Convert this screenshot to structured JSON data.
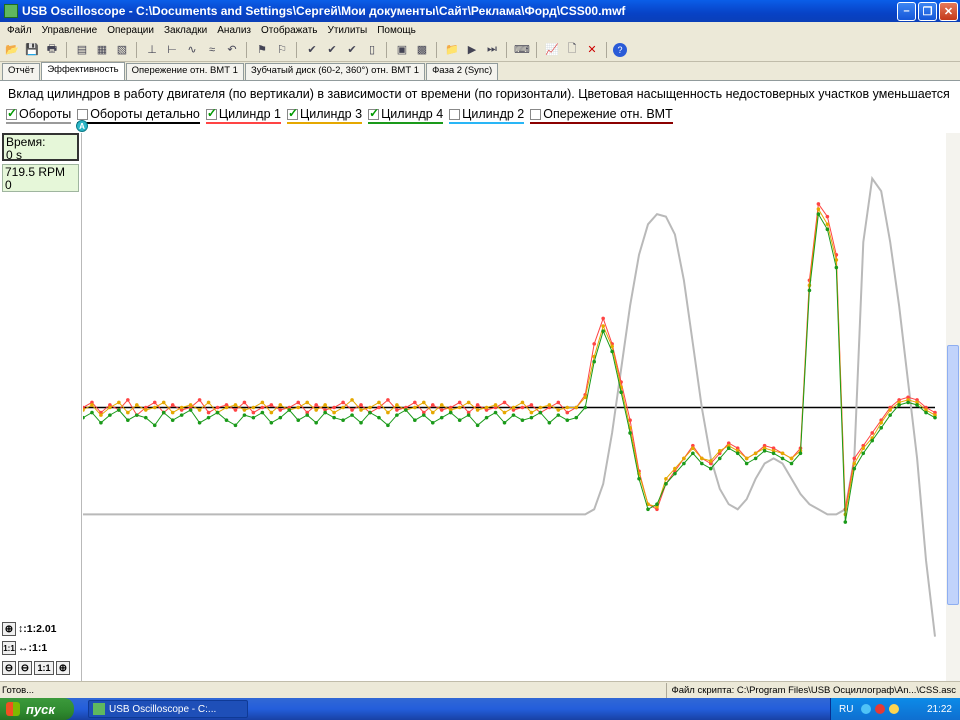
{
  "window": {
    "title": "USB Oscilloscope - C:\\Documents and Settings\\Сергей\\Мои документы\\Сайт\\Реклама\\Форд\\CSS00.mwf"
  },
  "menu": [
    "Файл",
    "Управление",
    "Операции",
    "Закладки",
    "Анализ",
    "Отображать",
    "Утилиты",
    "Помощь"
  ],
  "tabs": [
    "Отчёт",
    "Эффективность",
    "Опережение отн. ВМТ 1",
    "Зубчатый диск (60-2, 360°) отн. ВМТ 1",
    "Фаза 2 (Sync)"
  ],
  "description": "Вклад цилиндров в работу двигателя (по вертикали) в зависимости от времени (по горизонтали). Цветовая насыщенность недостоверных участков уменьшается",
  "legend": [
    {
      "label": "Обороты",
      "checked": true,
      "color": "#9a9a9a"
    },
    {
      "label": "Обороты детально",
      "checked": false,
      "color": "#000000"
    },
    {
      "label": "Цилиндр 1",
      "checked": true,
      "color": "#ff4444"
    },
    {
      "label": "Цилиндр 3",
      "checked": true,
      "color": "#e5a800"
    },
    {
      "label": "Цилиндр 4",
      "checked": true,
      "color": "#1a9a1a"
    },
    {
      "label": "Цилиндр 2",
      "checked": false,
      "color": "#29b6f6"
    },
    {
      "label": "Опережение отн. ВМТ",
      "checked": false,
      "color": "#8b0000"
    }
  ],
  "marker": "A",
  "info": {
    "time_label": "Время:",
    "time_value": "0 s",
    "rpm_value": "719.5 RPM",
    "rpm_sub": "0"
  },
  "zoom": {
    "vertical": "↕:1:2.01",
    "horizontal": "↔:1:1",
    "ratio_btn": "1:1"
  },
  "status": {
    "left": "Готов...",
    "right": "Файл скрипта: C:\\Program Files\\USB Осциллограф\\An...\\CSS.asc"
  },
  "taskbar": {
    "start": "пуск",
    "item": "USB Oscilloscope - C:...",
    "lang": "RU",
    "clock": "21:22"
  },
  "chart_data": {
    "type": "line",
    "series": [
      {
        "color": "#b9b9b9",
        "values": [
          58,
          58,
          58,
          58,
          58,
          58,
          58,
          58,
          58,
          58,
          58,
          58,
          58,
          58,
          58,
          58,
          58,
          58,
          58,
          58,
          58,
          58,
          58,
          58,
          58,
          58,
          58,
          58,
          58,
          58,
          58,
          58,
          58,
          58,
          58,
          58,
          58,
          58,
          58,
          58,
          58,
          58,
          58,
          58,
          58,
          58,
          58,
          58,
          58,
          58,
          58,
          58,
          58,
          58,
          58,
          58,
          58,
          60,
          70,
          90,
          115,
          140,
          160,
          172,
          176,
          175,
          168,
          150,
          125,
          100,
          80,
          68,
          62,
          60,
          64,
          72,
          78,
          80,
          78,
          72,
          66,
          62,
          60,
          58,
          58,
          60,
          80,
          165,
          190,
          185,
          165,
          140,
          110,
          80,
          40,
          10
        ]
      },
      {
        "color": "#ff4444",
        "values": [
          100,
          102,
          98,
          101,
          99,
          103,
          97,
          100,
          102,
          98,
          101,
          99,
          100,
          103,
          98,
          100,
          101,
          99,
          102,
          98,
          100,
          101,
          99,
          100,
          102,
          98,
          101,
          99,
          100,
          102,
          99,
          101,
          98,
          100,
          103,
          99,
          100,
          102,
          98,
          101,
          99,
          100,
          102,
          98,
          101,
          99,
          100,
          102,
          99,
          100,
          101,
          98,
          100,
          102,
          98,
          100,
          105,
          125,
          135,
          125,
          110,
          95,
          75,
          62,
          60,
          70,
          75,
          80,
          85,
          80,
          78,
          82,
          86,
          84,
          80,
          82,
          85,
          84,
          82,
          80,
          84,
          150,
          180,
          175,
          160,
          60,
          80,
          85,
          90,
          95,
          100,
          103,
          104,
          103,
          100,
          98
        ]
      },
      {
        "color": "#e5a800",
        "values": [
          99,
          101,
          97,
          100,
          102,
          98,
          101,
          99,
          100,
          102,
          98,
          100,
          101,
          99,
          102,
          98,
          100,
          101,
          99,
          100,
          102,
          98,
          101,
          99,
          100,
          102,
          99,
          101,
          98,
          100,
          103,
          99,
          100,
          102,
          98,
          101,
          99,
          100,
          102,
          98,
          101,
          99,
          100,
          102,
          99,
          100,
          101,
          98,
          100,
          102,
          98,
          100,
          101,
          99,
          100,
          100,
          104,
          120,
          132,
          124,
          108,
          92,
          74,
          62,
          61,
          72,
          76,
          80,
          84,
          80,
          79,
          83,
          85,
          83,
          80,
          82,
          84,
          83,
          82,
          80,
          83,
          148,
          178,
          172,
          158,
          58,
          78,
          84,
          88,
          94,
          99,
          102,
          103,
          102,
          99,
          97
        ]
      },
      {
        "color": "#1a9a1a",
        "values": [
          96,
          98,
          94,
          97,
          99,
          95,
          97,
          96,
          93,
          98,
          95,
          97,
          99,
          94,
          96,
          98,
          95,
          93,
          97,
          96,
          98,
          94,
          96,
          99,
          95,
          97,
          94,
          98,
          96,
          95,
          97,
          94,
          98,
          96,
          93,
          97,
          99,
          95,
          97,
          94,
          96,
          98,
          95,
          97,
          93,
          96,
          98,
          94,
          97,
          95,
          96,
          98,
          94,
          97,
          95,
          96,
          100,
          118,
          130,
          122,
          106,
          90,
          72,
          60,
          62,
          70,
          74,
          78,
          82,
          78,
          76,
          80,
          84,
          82,
          78,
          80,
          83,
          82,
          80,
          78,
          82,
          146,
          176,
          170,
          155,
          55,
          76,
          82,
          87,
          92,
          97,
          101,
          102,
          101,
          98,
          96
        ]
      }
    ],
    "baseline": 100,
    "ylim": [
      0,
      200
    ],
    "legend_position": "top-left"
  }
}
